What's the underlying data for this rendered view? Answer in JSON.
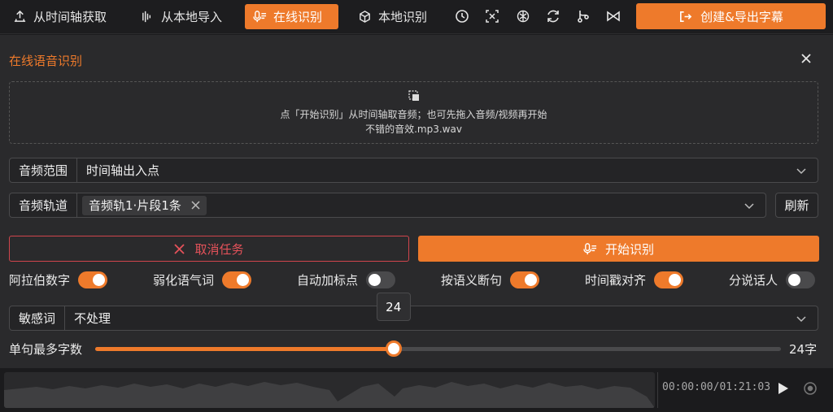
{
  "toolbar": {
    "timeline_fetch": "从时间轴获取",
    "local_import": "从本地导入",
    "online_recognize": "在线识别",
    "local_recognize": "本地识别",
    "export": "创建&导出字幕"
  },
  "panel": {
    "title": "在线语音识别",
    "dropzone_line1": "点「开始识别」从时间轴取音频；也可先拖入音频/视频再开始",
    "dropzone_line2": "不错的音效.mp3.wav"
  },
  "audio_range": {
    "label": "音频范围",
    "value": "时间轴出入点"
  },
  "audio_track": {
    "label": "音频轨道",
    "tag": "音频轨1·片段1条",
    "refresh": "刷新"
  },
  "actions": {
    "cancel": "取消任务",
    "start": "开始识别"
  },
  "options": [
    {
      "label": "阿拉伯数字",
      "on": true
    },
    {
      "label": "弱化语气词",
      "on": true
    },
    {
      "label": "自动加标点",
      "on": false
    },
    {
      "label": "按语义断句",
      "on": true
    },
    {
      "label": "时间戳对齐",
      "on": true
    },
    {
      "label": "分说话人",
      "on": false
    }
  ],
  "sensitive": {
    "label": "敏感词",
    "value": "不处理"
  },
  "slider": {
    "label": "单句最多字数",
    "tooltip": "24",
    "value_text": "24字",
    "value": 24,
    "fill_fraction": 0.435
  },
  "player": {
    "time": "00:00:00/01:21:03"
  },
  "colors": {
    "accent": "#ee7a2b",
    "danger": "#e5525a",
    "panel": "#2a2a2c"
  }
}
